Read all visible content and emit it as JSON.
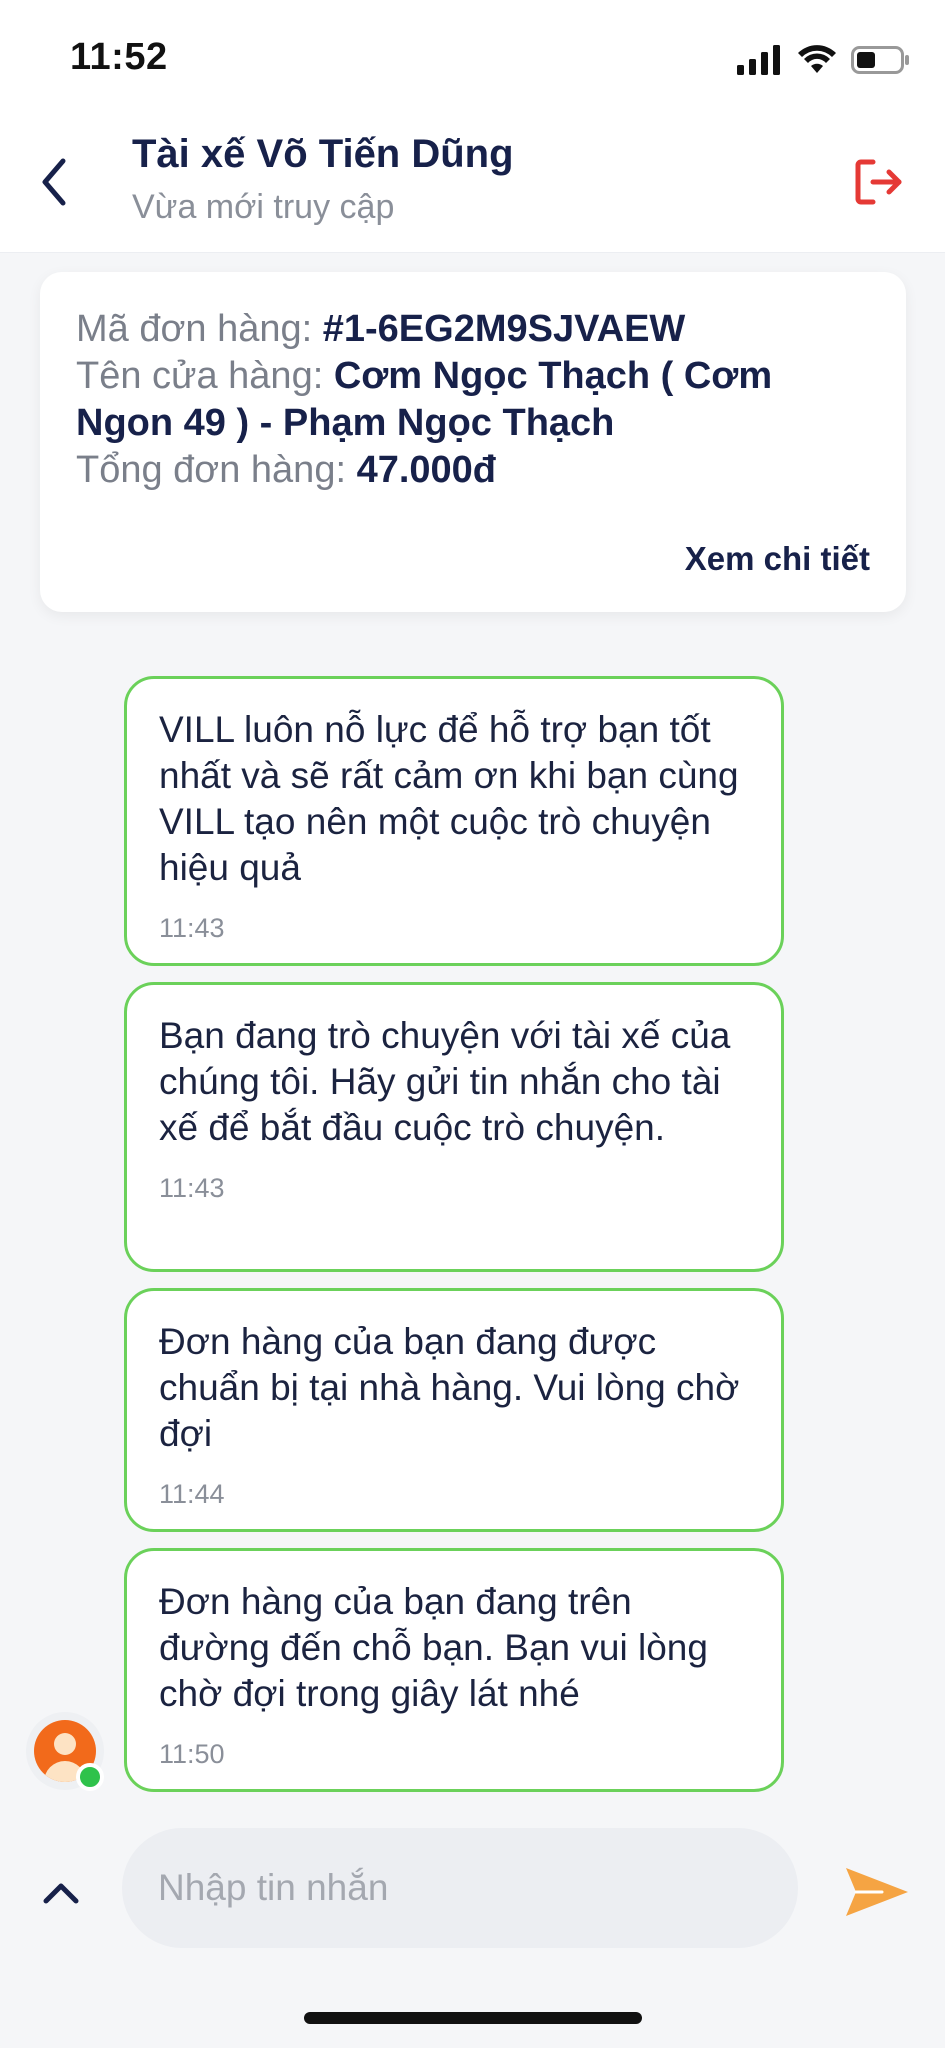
{
  "status_bar": {
    "time": "11:52",
    "icons": [
      "signal-icon",
      "wifi-icon",
      "battery-icon"
    ]
  },
  "header": {
    "title": "Tài xế Võ Tiến Dũng",
    "subtitle": "Vừa mới truy cập",
    "back_icon": "chevron-left-icon",
    "exit_icon": "logout-icon"
  },
  "order": {
    "code_label": "Mã đơn hàng: ",
    "code_value": "#1-6EG2M9SJVAEW",
    "store_label": "Tên cửa hàng: ",
    "store_value": "Cơm Ngọc Thạch ( Cơm Ngon 49 ) - Phạm Ngọc Thạch",
    "total_label": "Tổng đơn hàng: ",
    "total_value": "47.000đ",
    "detail_link": "Xem chi tiết"
  },
  "messages": [
    {
      "text": "VILL luôn nỗ lực để hỗ trợ bạn tốt nhất và sẽ rất cảm ơn khi bạn cùng VILL tạo nên một cuộc trò chuyện hiệu quả",
      "time": "11:43"
    },
    {
      "text": "Bạn đang trò chuyện với tài xế của chúng tôi. Hãy gửi tin nhắn cho tài xế để bắt đầu cuộc trò chuyện.",
      "time": "11:43"
    },
    {
      "text": "Đơn hàng của bạn đang được chuẩn bị tại nhà hàng. Vui lòng chờ đợi",
      "time": "11:44"
    },
    {
      "text": "Đơn hàng của bạn đang trên đường đến chỗ bạn. Bạn vui lòng chờ đợi trong giây lát nhé",
      "time": "11:50"
    }
  ],
  "composer": {
    "placeholder": "Nhập tin nhắn",
    "expand_icon": "chevron-up-icon",
    "send_icon": "send-icon"
  },
  "colors": {
    "accent_green": "#6bd15a",
    "online": "#2fc24b",
    "exit_red": "#e53935",
    "send_orange": "#f5a443",
    "title_navy": "#17214a"
  }
}
